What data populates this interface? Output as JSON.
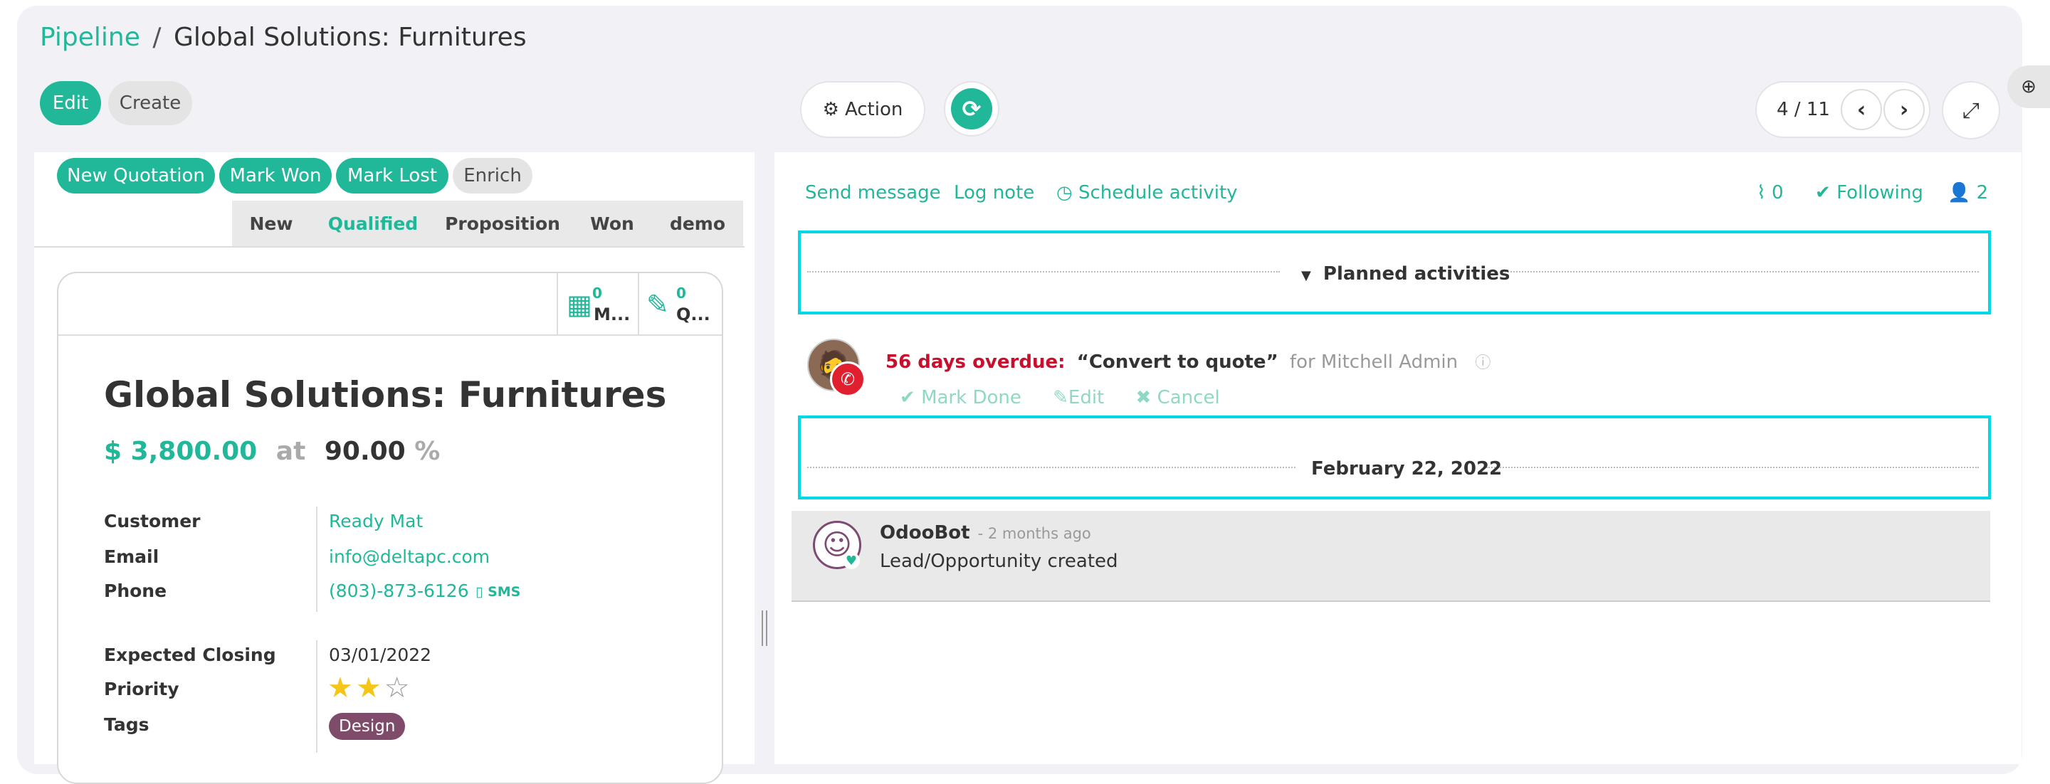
{
  "breadcrumb": {
    "parent": "Pipeline",
    "separator": "/",
    "current": "Global Solutions: Furnitures"
  },
  "control": {
    "edit_label": "Edit",
    "create_label": "Create",
    "action_label": "Action",
    "pager": "4 / 11"
  },
  "statusbar": {
    "buttons": [
      "New Quotation",
      "Mark Won",
      "Mark Lost",
      "Enrich"
    ],
    "stages": [
      "New",
      "Qualified",
      "Proposition",
      "Won",
      "demo"
    ],
    "active_stage": "Qualified"
  },
  "smart_buttons": [
    {
      "count": "0",
      "label": "M..."
    },
    {
      "count": "0",
      "label": "Q..."
    }
  ],
  "record": {
    "title": "Global Solutions: Furnitures",
    "revenue": "$ 3,800.00",
    "at": "at",
    "probability": "90.00",
    "percent": "%",
    "customer_label": "Customer",
    "customer": "Ready Mat",
    "email_label": "Email",
    "email": "info@deltapc.com",
    "phone_label": "Phone",
    "phone": "(803)-873-6126",
    "sms_label": "SMS",
    "closing_label": "Expected Closing",
    "closing": "03/01/2022",
    "priority_label": "Priority",
    "priority_stars": 2,
    "priority_max": 3,
    "tags_label": "Tags",
    "tag": "Design"
  },
  "chatter": {
    "send_message": "Send message",
    "log_note": "Log note",
    "schedule_activity": "Schedule activity",
    "attachments": "0",
    "following": "Following",
    "followers": "2",
    "planned_title": "Planned activities",
    "activity": {
      "overdue": "56 days overdue:",
      "summary": "“Convert to quote”",
      "assignee": "for Mitchell Admin",
      "mark_done": "Mark Done",
      "edit": "Edit",
      "cancel": "Cancel"
    },
    "date_separator": "February 22, 2022",
    "message": {
      "author": "OdooBot",
      "time": "- 2 months ago",
      "body": "Lead/Opportunity created"
    }
  },
  "colors": {
    "accent": "#21b799",
    "overdue": "#c8102e",
    "tag": "#7f4b6b",
    "highlight": "#00d8ea",
    "star": "#f5c518"
  }
}
